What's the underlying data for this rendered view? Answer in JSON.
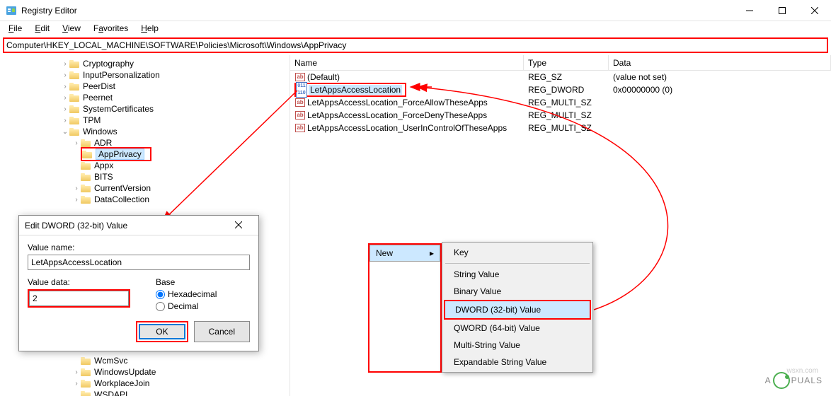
{
  "title": "Registry Editor",
  "menu": {
    "file": "File",
    "edit": "Edit",
    "view": "View",
    "favorites": "Favorites",
    "help": "Help"
  },
  "address": "Computer\\HKEY_LOCAL_MACHINE\\SOFTWARE\\Policies\\Microsoft\\Windows\\AppPrivacy",
  "tree": {
    "nodes": [
      "Cryptography",
      "InputPersonalization",
      "PeerDist",
      "Peernet",
      "SystemCertificates",
      "TPM",
      "Windows"
    ],
    "sub": [
      "ADR",
      "AppPrivacy",
      "Appx",
      "BITS",
      "CurrentVersion",
      "DataCollection"
    ],
    "tail": [
      "WcmSvc",
      "WindowsUpdate",
      "WorkplaceJoin",
      "WSDAPI"
    ]
  },
  "cols": {
    "name": "Name",
    "type": "Type",
    "data": "Data"
  },
  "rows": [
    {
      "name": "(Default)",
      "type": "REG_SZ",
      "data": "(value not set)",
      "ico": "ab"
    },
    {
      "name": "LetAppsAccessLocation",
      "type": "REG_DWORD",
      "data": "0x00000000 (0)",
      "ico": "bin",
      "hl": true
    },
    {
      "name": "LetAppsAccessLocation_ForceAllowTheseApps",
      "type": "REG_MULTI_SZ",
      "data": "",
      "ico": "ab"
    },
    {
      "name": "LetAppsAccessLocation_ForceDenyTheseApps",
      "type": "REG_MULTI_SZ",
      "data": "",
      "ico": "ab"
    },
    {
      "name": "LetAppsAccessLocation_UserInControlOfTheseApps",
      "type": "REG_MULTI_SZ",
      "data": "",
      "ico": "ab"
    }
  ],
  "dialog": {
    "title": "Edit DWORD (32-bit) Value",
    "value_name_label": "Value name:",
    "value_name": "LetAppsAccessLocation",
    "value_data_label": "Value data:",
    "value_data": "2",
    "base_label": "Base",
    "hex": "Hexadecimal",
    "dec": "Decimal",
    "ok": "OK",
    "cancel": "Cancel"
  },
  "ctx": {
    "new": "New",
    "items": [
      "Key",
      "String Value",
      "Binary Value",
      "DWORD (32-bit) Value",
      "QWORD (64-bit) Value",
      "Multi-String Value",
      "Expandable String Value"
    ]
  },
  "wm": {
    "brand_pre": "A",
    "brand_post": "PUALS",
    "src": "wsxn.com"
  }
}
